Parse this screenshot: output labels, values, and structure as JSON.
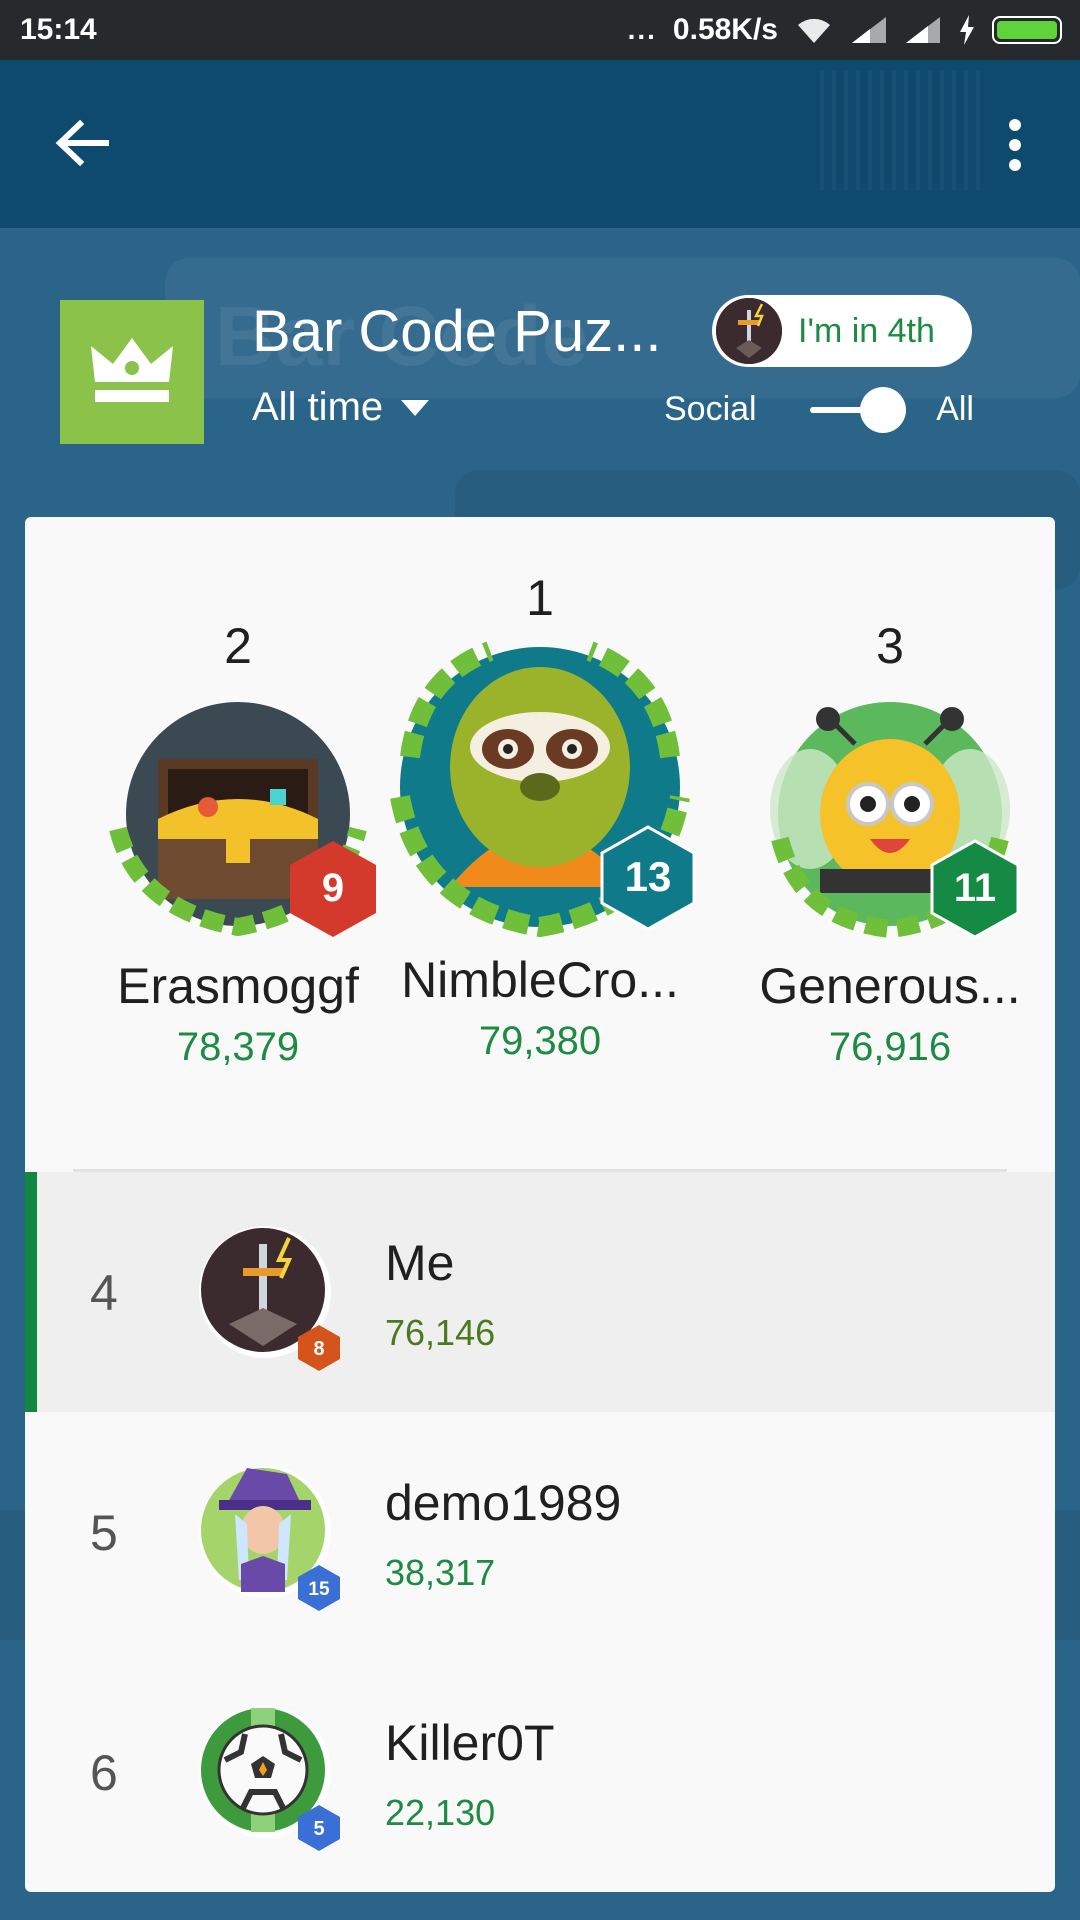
{
  "status_bar": {
    "time": "15:14",
    "dots": "...",
    "net_speed": "0.58K/s",
    "icons": [
      "wifi-icon",
      "signal-icon",
      "signal-icon",
      "charging-icon",
      "battery-icon"
    ]
  },
  "app_bar": {
    "back_icon": "arrow-left-icon",
    "more_icon": "more-vert-icon"
  },
  "header": {
    "game_icon": "crown-icon",
    "game_title": "Bar Code Puz...",
    "time_filter": "All time",
    "rank_pill": "I'm in 4th",
    "toggle_left": "Social",
    "toggle_right": "All",
    "toggle_on": true,
    "ghost_text": "Bar Code"
  },
  "podium": [
    {
      "rank": "2",
      "name": "Erasmoggf",
      "score": "78,379",
      "level": "9",
      "badge_color": "#d33a2c",
      "avatar": "treasure-chest"
    },
    {
      "rank": "1",
      "name": "NimbleCro...",
      "score": "79,380",
      "level": "13",
      "badge_color": "#0e7a8a",
      "avatar": "sloth"
    },
    {
      "rank": "3",
      "name": "Generous...",
      "score": "76,916",
      "level": "11",
      "badge_color": "#148a45",
      "avatar": "bee"
    }
  ],
  "rows": [
    {
      "rank": "4",
      "name": "Me",
      "score": "76,146",
      "level": "8",
      "badge_color": "#d4541c",
      "avatar": "sword",
      "highlight": true,
      "score_color": "#4a7a1e"
    },
    {
      "rank": "5",
      "name": "demo1989",
      "score": "38,317",
      "level": "15",
      "badge_color": "#3a6fd6",
      "avatar": "wizard",
      "highlight": false
    },
    {
      "rank": "6",
      "name": "Killer0T",
      "score": "22,130",
      "level": "5",
      "badge_color": "#3a6fd6",
      "avatar": "soccer-ball",
      "highlight": false
    }
  ],
  "colors": {
    "app_bar": "#0e4a6e",
    "background": "#2a6488",
    "accent_green": "#1e8a43",
    "game_icon": "#8bc34a"
  }
}
